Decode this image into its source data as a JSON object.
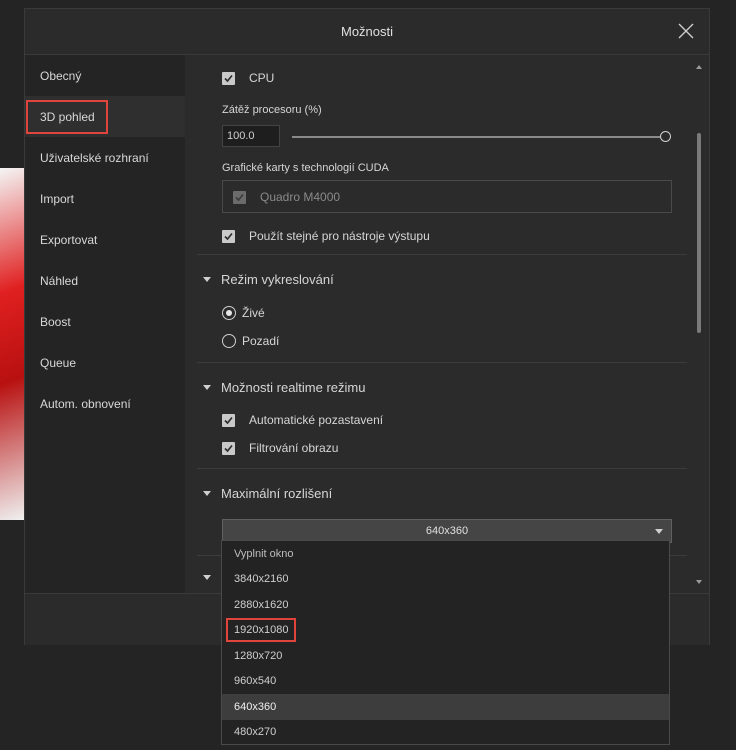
{
  "dialog": {
    "title": "Možnosti"
  },
  "sidebar": {
    "items": [
      {
        "label": "Obecný"
      },
      {
        "label": "3D pohled"
      },
      {
        "label": "Uživatelské rozhraní"
      },
      {
        "label": "Import"
      },
      {
        "label": "Exportovat"
      },
      {
        "label": "Náhled"
      },
      {
        "label": "Boost"
      },
      {
        "label": "Queue"
      },
      {
        "label": "Autom. obnovení"
      }
    ],
    "active_index": 1
  },
  "cpu": {
    "checkbox_label": "CPU",
    "checked": true,
    "load_label": "Zátěž procesoru (%)",
    "load_value": "100.0",
    "slider_fraction": 1.0
  },
  "gpu": {
    "label": "Grafické karty s technologií CUDA",
    "devices": [
      {
        "name": "Quadro M4000",
        "checked": true,
        "disabled": true
      }
    ],
    "same_for_output_label": "Použít stejné pro nástroje výstupu",
    "same_for_output_checked": true
  },
  "render_mode": {
    "title": "Režim vykreslování",
    "options": [
      {
        "label": "Živé",
        "selected": true
      },
      {
        "label": "Pozadí",
        "selected": false
      }
    ]
  },
  "realtime": {
    "title": "Možnosti realtime režimu",
    "auto_pause_label": "Automatické pozastavení",
    "auto_pause_checked": true,
    "filtering_label": "Filtrování obrazu",
    "filtering_checked": true
  },
  "max_resolution": {
    "title": "Maximální rozlišení",
    "selected_value": "640x360",
    "options": [
      "Vyplnit okno",
      "3840x2160",
      "2880x1620",
      "1920x1080",
      "1280x720",
      "960x540",
      "640x360",
      "480x270"
    ],
    "highlighted_option": "1920x1080"
  },
  "colors": {
    "highlight_border": "#e0443a",
    "dialog_bg": "#2b2b2b",
    "sidebar_bg": "#242424"
  },
  "icons": {
    "close": "close-icon",
    "check": "check-icon",
    "expand": "chevron-down-icon"
  }
}
